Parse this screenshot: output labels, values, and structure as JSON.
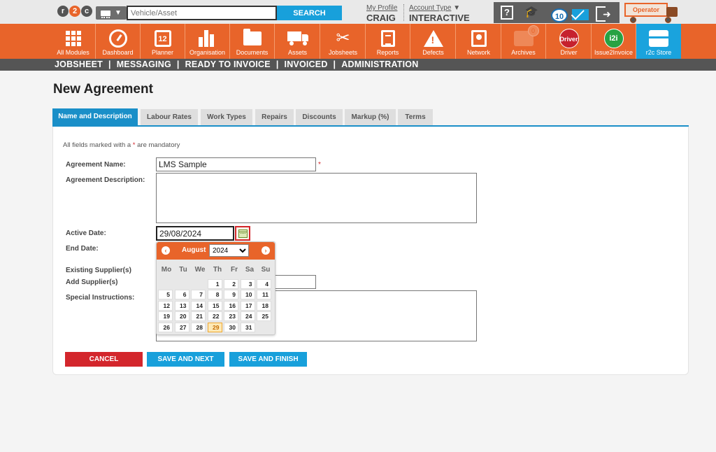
{
  "topbar": {
    "logo_text": "r2c",
    "search_placeholder": "Vehicle/Asset",
    "search_button": "SEARCH",
    "my_profile_link": "My Profile",
    "profile_name": "CRAIG",
    "account_type_link": "Account Type",
    "account_type_value": "INTERACTIVE",
    "notification_count": "10",
    "operator_label": "Operator"
  },
  "modules": [
    {
      "label": "All Modules",
      "icon": "grid-icon"
    },
    {
      "label": "Dashboard",
      "icon": "gauge-icon"
    },
    {
      "label": "Planner",
      "icon": "calendar-icon",
      "badge": "12"
    },
    {
      "label": "Organisation",
      "icon": "building-icon"
    },
    {
      "label": "Documents",
      "icon": "folder-icon"
    },
    {
      "label": "Assets",
      "icon": "truck-icon"
    },
    {
      "label": "Jobsheets",
      "icon": "tools-icon"
    },
    {
      "label": "Reports",
      "icon": "report-icon"
    },
    {
      "label": "Defects",
      "icon": "warning-icon"
    },
    {
      "label": "Network",
      "icon": "contact-icon"
    },
    {
      "label": "Archives",
      "icon": "archive-icon"
    },
    {
      "label": "Driver",
      "icon": "driver-icon"
    },
    {
      "label": "Issue2Invoice",
      "icon": "i2i-icon"
    },
    {
      "label": "r2c Store",
      "icon": "store-icon"
    }
  ],
  "module_icon_text": {
    "driver": "Driver",
    "i2i": "i2i"
  },
  "subnav": [
    "JOBSHEET",
    "MESSAGING",
    "READY TO INVOICE",
    "INVOICED",
    "ADMINISTRATION"
  ],
  "page": {
    "title": "New Agreement"
  },
  "tabs": [
    "Name and Description",
    "Labour Rates",
    "Work Types",
    "Repairs",
    "Discounts",
    "Markup (%)",
    "Terms"
  ],
  "form": {
    "mandatory_note_pre": "All fields marked with a",
    "mandatory_star": "*",
    "mandatory_note_post": "are mandatory",
    "agreement_name_label": "Agreement Name:",
    "agreement_name_value": "LMS Sample",
    "agreement_description_label": "Agreement Description:",
    "active_date_label": "Active Date:",
    "active_date_value": "29/08/2024",
    "end_date_label": "End Date:",
    "existing_suppliers_label": "Existing Supplier(s)",
    "add_supplier_label": "Add Supplier(s)",
    "special_instructions_label": "Special Instructions:"
  },
  "datepicker": {
    "month": "August",
    "year": "2024",
    "prev": "‹",
    "next": "›",
    "weekdays": [
      "Mo",
      "Tu",
      "We",
      "Th",
      "Fr",
      "Sa",
      "Su"
    ],
    "weeks": [
      [
        "",
        "",
        "",
        "1",
        "2",
        "3",
        "4"
      ],
      [
        "5",
        "6",
        "7",
        "8",
        "9",
        "10",
        "11"
      ],
      [
        "12",
        "13",
        "14",
        "15",
        "16",
        "17",
        "18"
      ],
      [
        "19",
        "20",
        "21",
        "22",
        "23",
        "24",
        "25"
      ],
      [
        "26",
        "27",
        "28",
        "29",
        "30",
        "31",
        ""
      ]
    ],
    "selected_day": "29"
  },
  "buttons": {
    "cancel": "CANCEL",
    "save_next": "SAVE AND NEXT",
    "save_finish": "SAVE AND FINISH"
  },
  "colors": {
    "brand_orange": "#e8642a",
    "accent_blue": "#18a0db",
    "danger_red": "#d3262c",
    "subnav_grey": "#555555"
  }
}
